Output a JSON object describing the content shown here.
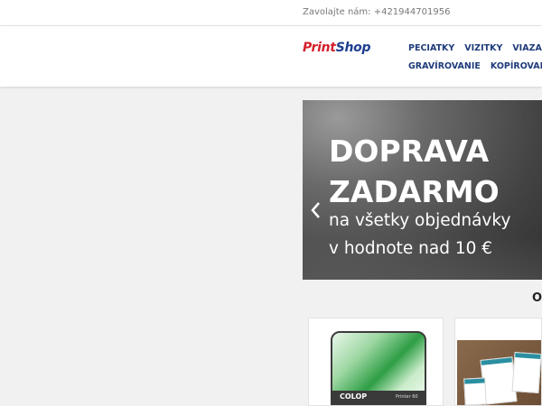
{
  "topbar": {
    "phone_text": "Zavolajte nám: +421944701956"
  },
  "header": {
    "logo": {
      "part1": "Print",
      "part2": "Shop"
    },
    "nav_row1": [
      "PEČIATKY",
      "VIZITKY",
      "VIAZANIE"
    ],
    "nav_row2": [
      "GRAVÍROVANIE",
      "KOPÍROVANIE"
    ]
  },
  "hero": {
    "title_line1": "DOPRAVA",
    "title_line2": "ZADARMO",
    "sub_line1": "na všetky objednávky",
    "sub_line2": "v hodnote nad 10 €"
  },
  "section_peek": "O",
  "products": [
    {
      "brand": "COLOP",
      "model": "Printer 60"
    },
    {
      "label": ""
    }
  ],
  "colors": {
    "nav": "#1f3c7a",
    "logo_red": "#d4202c",
    "logo_blue": "#1d3e8f"
  }
}
